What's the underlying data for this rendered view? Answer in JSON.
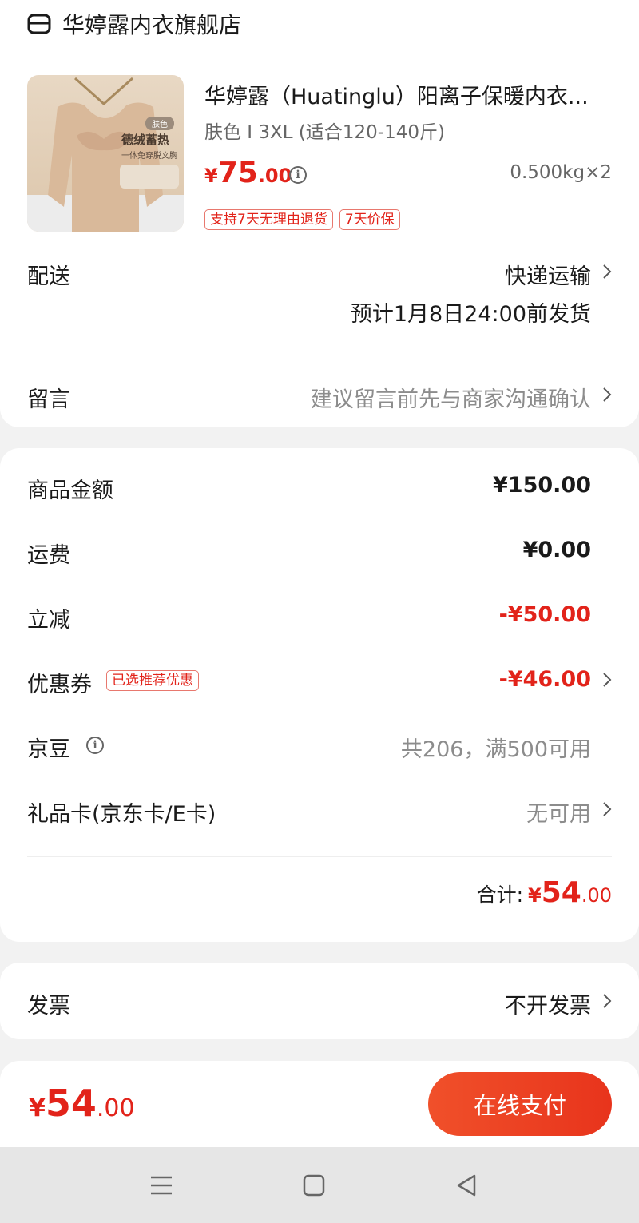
{
  "store": {
    "name": "华婷露内衣旗舰店",
    "icon": "store-icon"
  },
  "product": {
    "title": "华婷露（Huatinglu）阳离子保暖内衣...",
    "spec": "肤色 I 3XL (适合120-140斤)",
    "price_symbol": "¥",
    "price_int": "75",
    "price_dec": ".00",
    "weight_qty": "0.500kg×2",
    "tags": [
      "支持7天无理由退货",
      "7天价保"
    ],
    "image_caption": "德绒蓄热",
    "image_badge": "肤色",
    "image_sub": "一体免穿脱文胸"
  },
  "delivery": {
    "label": "配送",
    "method": "快递运输",
    "eta": "预计1月8日24:00前发货"
  },
  "message": {
    "label": "留言",
    "placeholder": "建议留言前先与商家沟通确认"
  },
  "summary": {
    "goods_label": "商品金额",
    "goods_value": "¥150.00",
    "shipping_label": "运费",
    "shipping_value": "¥0.00",
    "discount_label": "立减",
    "discount_value": "-¥50.00",
    "coupon_label": "优惠券",
    "coupon_tag": "已选推荐优惠",
    "coupon_value": "-¥46.00",
    "beans_label": "京豆",
    "beans_value": "共206，满500可用",
    "giftcard_label": "礼品卡(京东卡/E卡)",
    "giftcard_value": "无可用",
    "total_label": "合计:",
    "total_symbol": "¥",
    "total_int": "54",
    "total_dec": ".00"
  },
  "invoice": {
    "label": "发票",
    "value": "不开发票"
  },
  "pay": {
    "symbol": "¥",
    "amount_int": "54",
    "amount_dec": ".00",
    "button_label": "在线支付"
  },
  "colors": {
    "accent": "#e2231a",
    "button": "#ec3f22"
  }
}
